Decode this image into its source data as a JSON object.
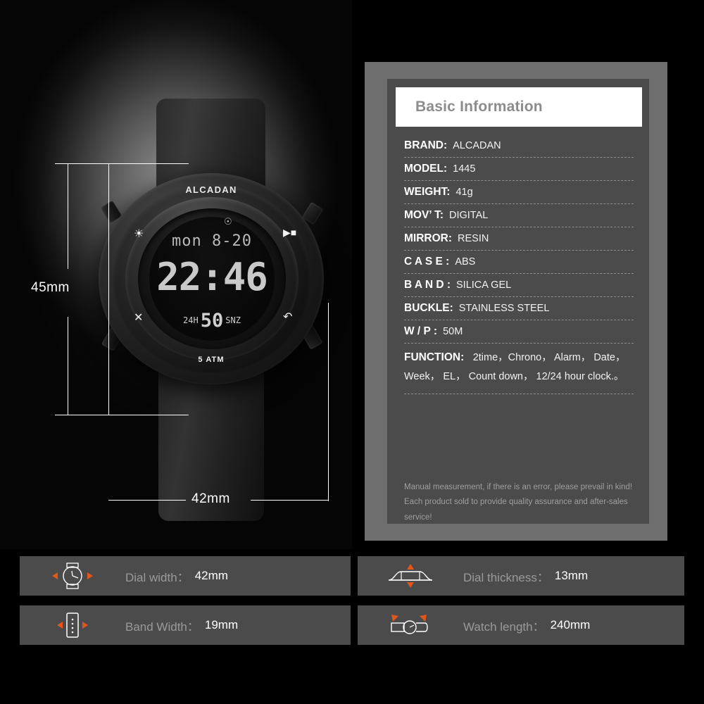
{
  "product_photo": {
    "dial_brand": "ALCADAN",
    "water_mark": "5 ATM",
    "lcd": {
      "day_date": "mon 8-20",
      "time": "22:46",
      "format_label": "24H",
      "seconds": "50",
      "snooze_label": "SNZ"
    },
    "dial_icons": {
      "light": "sun-icon",
      "mode": "tool-icon",
      "start": "play-pause-icon",
      "reset": "back-arrow-icon",
      "alarm": "bell-icon"
    },
    "dimensions": {
      "height_label": "45mm",
      "width_label": "42mm"
    }
  },
  "spec_panel": {
    "title": "Basic Information",
    "rows": [
      {
        "label": "BRAND:",
        "value": "ALCADAN"
      },
      {
        "label": "MODEL:",
        "value": "1445"
      },
      {
        "label": "WEIGHT:",
        "value": "41g"
      },
      {
        "label": "MOV’ T:",
        "value": "DIGITAL"
      },
      {
        "label": "MIRROR:",
        "value": "RESIN"
      },
      {
        "label": "C A S E :",
        "value": "ABS"
      },
      {
        "label": "B A N D :",
        "value": "SILICA GEL"
      },
      {
        "label": "BUCKLE:",
        "value": "STAINLESS STEEL"
      },
      {
        "label": "W / P  :",
        "value": "50M"
      }
    ],
    "function_row": {
      "label": "FUNCTION:",
      "value": "2time，Chrono， Alarm， Date， Week， EL， Count down， 12/24 hour clock.。"
    },
    "notes": [
      "Manual measurement, if there is an error, please prevail in kind!",
      "Each product sold to provide quality assurance and after-sales service!"
    ]
  },
  "cards": [
    {
      "icon": "watch-dial-icon",
      "label": "Dial width：",
      "value": "42mm"
    },
    {
      "icon": "watch-side-icon",
      "label": "Dial thickness：",
      "value": "13mm"
    },
    {
      "icon": "watch-band-icon",
      "label": "Band Width：",
      "value": "19mm"
    },
    {
      "icon": "watch-length-icon",
      "label": "Watch length：",
      "value": "240mm"
    }
  ],
  "colors": {
    "accent_orange": "#e0561c",
    "panel_frame": "#6e6e6e",
    "panel_body": "#4b4b4b",
    "title_bar": "#ffffff",
    "label_gray": "#9a9a9a"
  }
}
